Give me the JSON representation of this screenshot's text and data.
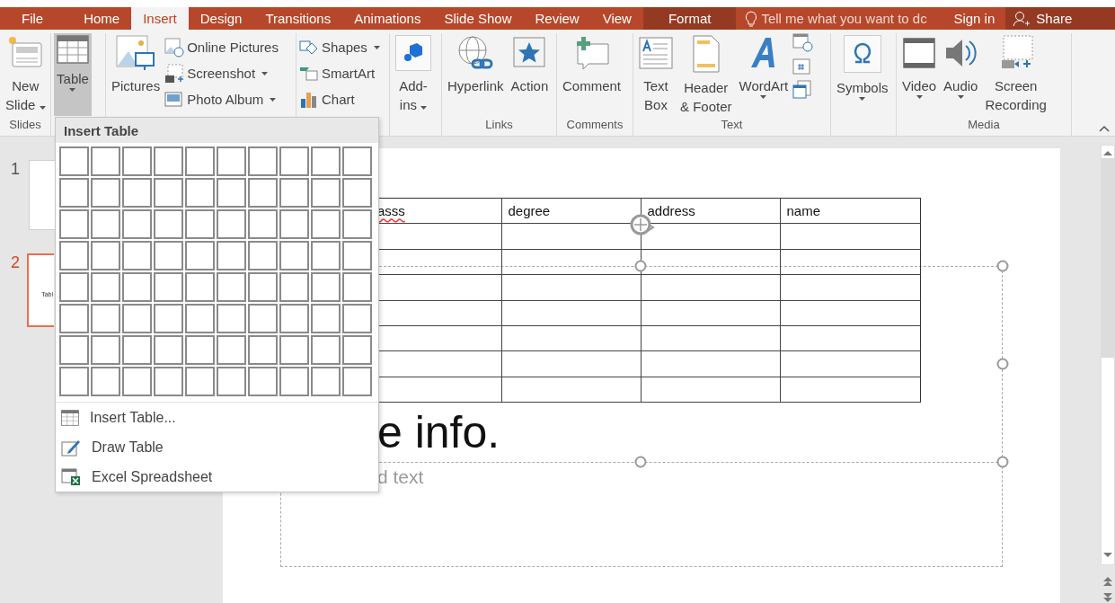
{
  "tabs": [
    {
      "label": "File",
      "selected": false,
      "kind": "plain"
    },
    {
      "label": "Home",
      "selected": false,
      "kind": "plain"
    },
    {
      "label": "Insert",
      "selected": true,
      "kind": "plain"
    },
    {
      "label": "Design",
      "selected": false,
      "kind": "plain"
    },
    {
      "label": "Transitions",
      "selected": false,
      "kind": "plain"
    },
    {
      "label": "Animations",
      "selected": false,
      "kind": "plain"
    },
    {
      "label": "Slide Show",
      "selected": false,
      "kind": "plain"
    },
    {
      "label": "Review",
      "selected": false,
      "kind": "plain"
    },
    {
      "label": "View",
      "selected": false,
      "kind": "plain"
    },
    {
      "label": "Format",
      "selected": false,
      "kind": "context"
    }
  ],
  "tell_me": {
    "placeholder": "Tell me what you want to dc"
  },
  "sign_in": "Sign in",
  "share": "Share",
  "ribbon": {
    "groups": [
      {
        "label": "Slides",
        "commands": [
          {
            "kind": "large",
            "lines": [
              "New",
              "Slide"
            ],
            "dropdown": true
          }
        ]
      },
      {
        "commands": [
          {
            "kind": "large",
            "lines": [
              "Table"
            ],
            "dropdown": true,
            "pressed": true
          }
        ]
      },
      {
        "commands": [
          {
            "kind": "large",
            "lines": [
              "Pictures"
            ],
            "dropdown": false
          },
          {
            "kind": "small",
            "lines": [
              "Online Pictures"
            ],
            "dropdown": false
          },
          {
            "kind": "small",
            "lines": [
              "Screenshot"
            ],
            "dropdown": true
          },
          {
            "kind": "small",
            "lines": [
              "Photo Album"
            ],
            "dropdown": true
          }
        ]
      },
      {
        "commands": [
          {
            "kind": "small",
            "lines": [
              "Shapes"
            ],
            "dropdown": true
          },
          {
            "kind": "small",
            "lines": [
              "SmartArt"
            ],
            "dropdown": false
          },
          {
            "kind": "small",
            "lines": [
              "Chart"
            ],
            "dropdown": false
          }
        ]
      },
      {
        "commands": [
          {
            "kind": "large",
            "lines": [
              "Add-",
              "ins"
            ],
            "dropdown": true
          }
        ]
      },
      {
        "label": "Links",
        "commands": [
          {
            "kind": "large",
            "lines": [
              "Hyperlink"
            ],
            "dropdown": false
          },
          {
            "kind": "large",
            "lines": [
              "Action"
            ],
            "dropdown": false
          }
        ]
      },
      {
        "label": "Comments",
        "commands": [
          {
            "kind": "large",
            "lines": [
              "Comment"
            ],
            "dropdown": false
          }
        ]
      },
      {
        "label": "Text",
        "commands": [
          {
            "kind": "large",
            "lines": [
              "Text",
              "Box"
            ],
            "dropdown": false
          },
          {
            "kind": "large",
            "lines": [
              "Header",
              "& Footer"
            ],
            "dropdown": false
          },
          {
            "kind": "large",
            "lines": [
              "WordArt"
            ],
            "dropdown": true
          },
          {
            "kind": "stack"
          }
        ]
      },
      {
        "commands": [
          {
            "kind": "large",
            "lines": [
              "Symbols"
            ],
            "dropdown": true
          }
        ]
      },
      {
        "label": "Media",
        "commands": [
          {
            "kind": "large",
            "lines": [
              "Video"
            ],
            "dropdown": true
          },
          {
            "kind": "large",
            "lines": [
              "Audio"
            ],
            "dropdown": true
          },
          {
            "kind": "large",
            "lines": [
              "Screen",
              "Recording"
            ],
            "dropdown": false
          }
        ]
      }
    ]
  },
  "thumbnails": [
    {
      "number": "1",
      "selected": false
    },
    {
      "number": "2",
      "selected": true,
      "caption": "Tabl"
    }
  ],
  "slide": {
    "table": {
      "columns": [
        {
          "label": "asss",
          "misspelled": true
        },
        {
          "label": "degree",
          "misspelled": false
        },
        {
          "label": "address",
          "misspelled": false
        },
        {
          "label": "name",
          "misspelled": false
        }
      ],
      "rows": [
        {
          "kind": "empty"
        },
        {
          "kind": "empty"
        },
        {
          "kind": "empty"
        },
        {
          "kind": "empty"
        },
        {
          "kind": "empty"
        },
        {
          "kind": "empty"
        },
        {
          "kind": "empty"
        }
      ]
    },
    "title": "e info.",
    "body_placeholder": "d text"
  },
  "insert_table_menu": {
    "title": "Insert Table",
    "items": [
      {
        "label": "Insert Table..."
      },
      {
        "label": "Draw Table"
      },
      {
        "label": "Excel Spreadsheet"
      }
    ]
  }
}
